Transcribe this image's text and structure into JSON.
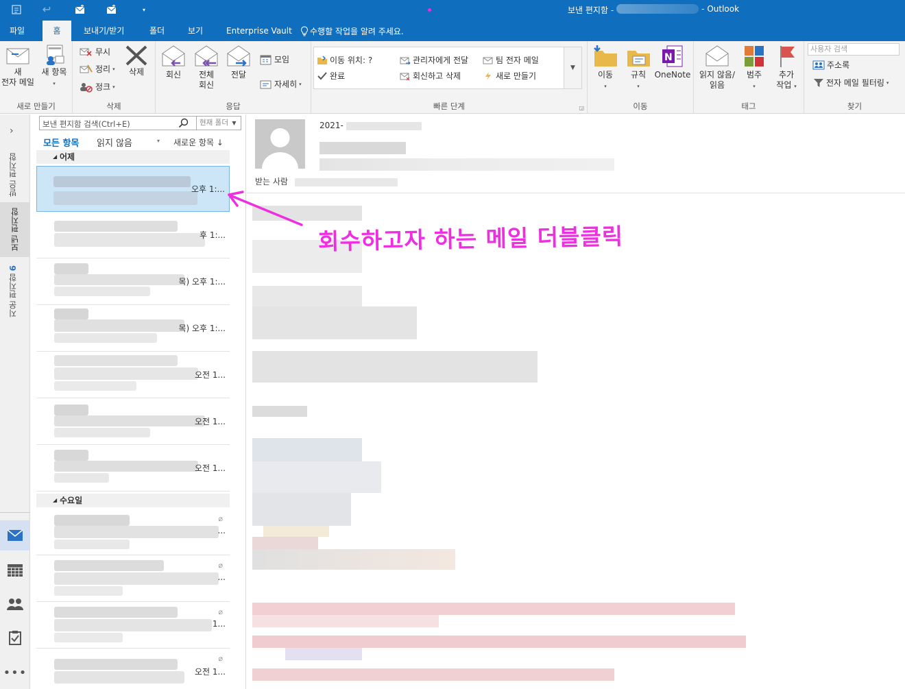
{
  "window": {
    "title_prefix": "보낸 편지함 -",
    "app_name": "- Outlook"
  },
  "tabs": [
    "파일",
    "홈",
    "보내기/받기",
    "폴더",
    "보기",
    "Enterprise Vault"
  ],
  "active_tab": "홈",
  "tell_me": "수행할 작업을 알려 주세요.",
  "ribbon": {
    "new": {
      "label": "새로 만들기",
      "new_email": [
        "새",
        "전자 메일"
      ],
      "new_items": "새 항목"
    },
    "delete": {
      "label": "삭제",
      "ignore": "무시",
      "clean_up": "정리",
      "junk": "정크",
      "delete_btn": "삭제"
    },
    "respond": {
      "label": "응답",
      "reply": "회신",
      "reply_all": [
        "전체",
        "회신"
      ],
      "forward": "전달",
      "meeting": "모임",
      "more": "자세히"
    },
    "quick_steps": {
      "label": "빠른 단계",
      "items": [
        "이동 위치: ?",
        "관리자에게 전달",
        "팀 전자 메일",
        "완료",
        "회신하고 삭제",
        "새로 만들기"
      ]
    },
    "move": {
      "label": "이동",
      "move_btn": "이동",
      "rules": "규칙",
      "onenote": "OneNote"
    },
    "tags": {
      "label": "태그",
      "unread_read": [
        "읽지 않음/",
        "읽음"
      ],
      "categorize": "범주",
      "follow_up": [
        "추가",
        "작업"
      ]
    },
    "find": {
      "label": "찾기",
      "search_people_placeholder": "사용자 검색",
      "address_book": "주소록",
      "filter_email": "전자 메일 필터링"
    }
  },
  "folders_vertical": {
    "inbox": "받은 편지함",
    "sent": "보낸 편지함",
    "deleted": "지운 편지함",
    "deleted_count": "6"
  },
  "mail_list": {
    "search_placeholder": "보낸 편지함 검색(Ctrl+E)",
    "search_scope": "현재 폴더",
    "filter_all": "모든 항목",
    "filter_unread": "읽지 않음",
    "sort_label": "새로운 항목 ↓",
    "groups": [
      {
        "name": "어제",
        "items": [
          {
            "time": "오후 1:..."
          },
          {
            "time": "후 1:..."
          },
          {
            "time": "목) 오후 1:..."
          },
          {
            "time": "목) 오후 1:..."
          },
          {
            "time": "오전 1..."
          },
          {
            "time": "오전 1..."
          },
          {
            "time": "오전 1..."
          }
        ]
      },
      {
        "name": "수요일",
        "items": [
          {
            "time": "..."
          },
          {
            "time": "..."
          },
          {
            "time": "1..."
          },
          {
            "time": "오전 1..."
          }
        ]
      }
    ]
  },
  "reading": {
    "date_prefix": "2021-",
    "to_label": "받는 사람"
  },
  "annotation": "회수하고자 하는 메일 더블클릭",
  "colors": {
    "brand": "#106ebe",
    "annotation": "#ee2ee0",
    "selected_row": "#cde6f7"
  }
}
